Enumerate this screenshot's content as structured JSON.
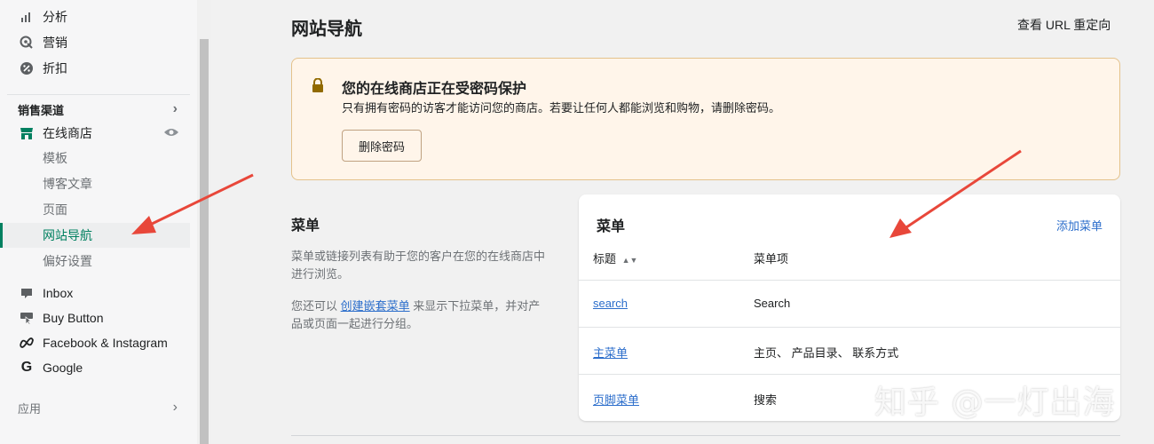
{
  "sidebar": {
    "top_items": [
      {
        "label": "分析",
        "icon": "bar-chart-icon"
      },
      {
        "label": "营销",
        "icon": "target-icon"
      },
      {
        "label": "折扣",
        "icon": "discount-icon"
      }
    ],
    "sales_channels_heading": "销售渠道",
    "online_store": {
      "label": "在线商店",
      "icon": "store-icon",
      "eye_icon": "eye-icon"
    },
    "sub_items": [
      "模板",
      "博客文章",
      "页面",
      "网站导航",
      "偏好设置"
    ],
    "active_sub_item": "网站导航",
    "channels": [
      {
        "label": "Inbox",
        "icon": "inbox-icon"
      },
      {
        "label": "Buy Button",
        "icon": "buy-button-icon"
      },
      {
        "label": "Facebook & Instagram",
        "icon": "meta-icon"
      },
      {
        "label": "Google",
        "icon": "google-icon"
      }
    ],
    "apps_heading": "应用"
  },
  "header": {
    "title": "网站导航",
    "redirect_link": "查看 URL 重定向"
  },
  "banner": {
    "title": "您的在线商店正在受密码保护",
    "description": "只有拥有密码的访客才能访问您的商店。若要让任何人都能浏览和购物，请删除密码。",
    "button": "删除密码",
    "color_bg": "#fff5ea",
    "color_border": "#e4c28b"
  },
  "menus_section": {
    "title": "菜单",
    "description": "菜单或链接列表有助于您的客户在您的在线商店中进行浏览。",
    "desc2_prefix": "您还可以",
    "desc2_link": "创建嵌套菜单",
    "desc2_suffix": "来显示下拉菜单，并对产品或页面一起进行分组。"
  },
  "menus_card": {
    "title": "菜单",
    "add_link": "添加菜单",
    "columns": [
      "标题",
      "菜单项"
    ],
    "rows": [
      {
        "title": "search",
        "items": "Search"
      },
      {
        "title": "主菜单",
        "items": "主页、 产品目录、 联系方式"
      },
      {
        "title": "页脚菜单",
        "items": "搜索"
      }
    ]
  },
  "watermark": "知乎 @一灯出海",
  "colors": {
    "accent": "#008060",
    "link": "#2c6ecb",
    "arrow": "#e8473a"
  }
}
